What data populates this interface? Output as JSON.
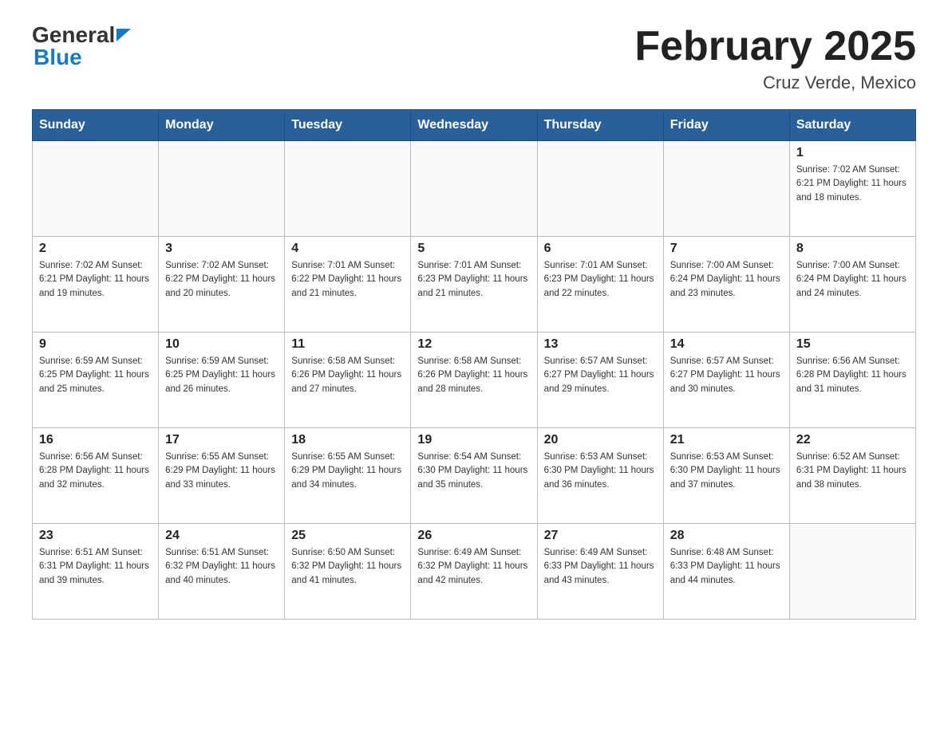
{
  "header": {
    "logo_general": "General",
    "logo_blue": "Blue",
    "title": "February 2025",
    "subtitle": "Cruz Verde, Mexico"
  },
  "days_of_week": [
    "Sunday",
    "Monday",
    "Tuesday",
    "Wednesday",
    "Thursday",
    "Friday",
    "Saturday"
  ],
  "weeks": [
    {
      "days": [
        {
          "number": "",
          "info": ""
        },
        {
          "number": "",
          "info": ""
        },
        {
          "number": "",
          "info": ""
        },
        {
          "number": "",
          "info": ""
        },
        {
          "number": "",
          "info": ""
        },
        {
          "number": "",
          "info": ""
        },
        {
          "number": "1",
          "info": "Sunrise: 7:02 AM\nSunset: 6:21 PM\nDaylight: 11 hours\nand 18 minutes."
        }
      ]
    },
    {
      "days": [
        {
          "number": "2",
          "info": "Sunrise: 7:02 AM\nSunset: 6:21 PM\nDaylight: 11 hours\nand 19 minutes."
        },
        {
          "number": "3",
          "info": "Sunrise: 7:02 AM\nSunset: 6:22 PM\nDaylight: 11 hours\nand 20 minutes."
        },
        {
          "number": "4",
          "info": "Sunrise: 7:01 AM\nSunset: 6:22 PM\nDaylight: 11 hours\nand 21 minutes."
        },
        {
          "number": "5",
          "info": "Sunrise: 7:01 AM\nSunset: 6:23 PM\nDaylight: 11 hours\nand 21 minutes."
        },
        {
          "number": "6",
          "info": "Sunrise: 7:01 AM\nSunset: 6:23 PM\nDaylight: 11 hours\nand 22 minutes."
        },
        {
          "number": "7",
          "info": "Sunrise: 7:00 AM\nSunset: 6:24 PM\nDaylight: 11 hours\nand 23 minutes."
        },
        {
          "number": "8",
          "info": "Sunrise: 7:00 AM\nSunset: 6:24 PM\nDaylight: 11 hours\nand 24 minutes."
        }
      ]
    },
    {
      "days": [
        {
          "number": "9",
          "info": "Sunrise: 6:59 AM\nSunset: 6:25 PM\nDaylight: 11 hours\nand 25 minutes."
        },
        {
          "number": "10",
          "info": "Sunrise: 6:59 AM\nSunset: 6:25 PM\nDaylight: 11 hours\nand 26 minutes."
        },
        {
          "number": "11",
          "info": "Sunrise: 6:58 AM\nSunset: 6:26 PM\nDaylight: 11 hours\nand 27 minutes."
        },
        {
          "number": "12",
          "info": "Sunrise: 6:58 AM\nSunset: 6:26 PM\nDaylight: 11 hours\nand 28 minutes."
        },
        {
          "number": "13",
          "info": "Sunrise: 6:57 AM\nSunset: 6:27 PM\nDaylight: 11 hours\nand 29 minutes."
        },
        {
          "number": "14",
          "info": "Sunrise: 6:57 AM\nSunset: 6:27 PM\nDaylight: 11 hours\nand 30 minutes."
        },
        {
          "number": "15",
          "info": "Sunrise: 6:56 AM\nSunset: 6:28 PM\nDaylight: 11 hours\nand 31 minutes."
        }
      ]
    },
    {
      "days": [
        {
          "number": "16",
          "info": "Sunrise: 6:56 AM\nSunset: 6:28 PM\nDaylight: 11 hours\nand 32 minutes."
        },
        {
          "number": "17",
          "info": "Sunrise: 6:55 AM\nSunset: 6:29 PM\nDaylight: 11 hours\nand 33 minutes."
        },
        {
          "number": "18",
          "info": "Sunrise: 6:55 AM\nSunset: 6:29 PM\nDaylight: 11 hours\nand 34 minutes."
        },
        {
          "number": "19",
          "info": "Sunrise: 6:54 AM\nSunset: 6:30 PM\nDaylight: 11 hours\nand 35 minutes."
        },
        {
          "number": "20",
          "info": "Sunrise: 6:53 AM\nSunset: 6:30 PM\nDaylight: 11 hours\nand 36 minutes."
        },
        {
          "number": "21",
          "info": "Sunrise: 6:53 AM\nSunset: 6:30 PM\nDaylight: 11 hours\nand 37 minutes."
        },
        {
          "number": "22",
          "info": "Sunrise: 6:52 AM\nSunset: 6:31 PM\nDaylight: 11 hours\nand 38 minutes."
        }
      ]
    },
    {
      "days": [
        {
          "number": "23",
          "info": "Sunrise: 6:51 AM\nSunset: 6:31 PM\nDaylight: 11 hours\nand 39 minutes."
        },
        {
          "number": "24",
          "info": "Sunrise: 6:51 AM\nSunset: 6:32 PM\nDaylight: 11 hours\nand 40 minutes."
        },
        {
          "number": "25",
          "info": "Sunrise: 6:50 AM\nSunset: 6:32 PM\nDaylight: 11 hours\nand 41 minutes."
        },
        {
          "number": "26",
          "info": "Sunrise: 6:49 AM\nSunset: 6:32 PM\nDaylight: 11 hours\nand 42 minutes."
        },
        {
          "number": "27",
          "info": "Sunrise: 6:49 AM\nSunset: 6:33 PM\nDaylight: 11 hours\nand 43 minutes."
        },
        {
          "number": "28",
          "info": "Sunrise: 6:48 AM\nSunset: 6:33 PM\nDaylight: 11 hours\nand 44 minutes."
        },
        {
          "number": "",
          "info": ""
        }
      ]
    }
  ]
}
